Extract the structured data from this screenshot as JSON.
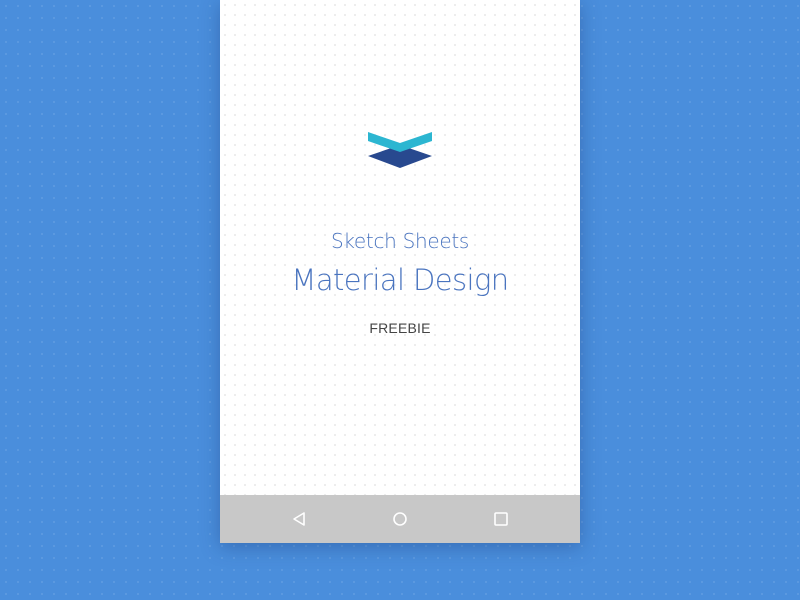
{
  "screen": {
    "subtitle": "Sketch Sheets",
    "title": "Material Design",
    "tag": "FREEBIE",
    "logo_icon": "layers-logo-icon"
  },
  "navbar": {
    "back_icon": "triangle-back-icon",
    "home_icon": "circle-home-icon",
    "recent_icon": "square-recents-icon"
  },
  "colors": {
    "background": "#4a8edc",
    "accent_text": "#4a74bf",
    "logo_top": "#2cb6d1",
    "logo_bottom": "#28498f",
    "navbar": "#c8c8c8"
  }
}
